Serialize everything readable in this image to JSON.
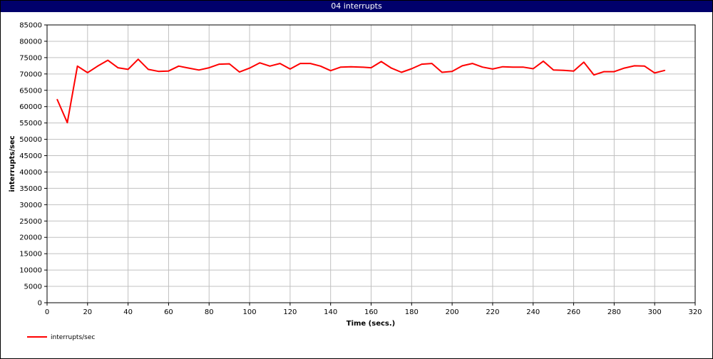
{
  "window": {
    "title": "04 interrupts"
  },
  "chart_data": {
    "type": "line",
    "title": "04 interrupts",
    "xlabel": "Time (secs.)",
    "ylabel": "interrupts/sec",
    "xlim": [
      0,
      320
    ],
    "ylim": [
      0,
      85000
    ],
    "x_ticks": [
      0,
      20,
      40,
      60,
      80,
      100,
      120,
      140,
      160,
      180,
      200,
      220,
      240,
      260,
      280,
      300,
      320
    ],
    "y_ticks": [
      0,
      5000,
      10000,
      15000,
      20000,
      25000,
      30000,
      35000,
      40000,
      45000,
      50000,
      55000,
      60000,
      65000,
      70000,
      75000,
      80000,
      85000
    ],
    "grid": true,
    "legend_position": "bottom-left",
    "colors": {
      "series": "#ff0000",
      "grid": "#c0c0c0",
      "titlebar": "#00006b"
    },
    "series": [
      {
        "name": "interrupts/sec",
        "x": [
          5,
          10,
          15,
          20,
          25,
          30,
          35,
          40,
          45,
          50,
          55,
          60,
          65,
          70,
          75,
          80,
          85,
          90,
          95,
          100,
          105,
          110,
          115,
          120,
          125,
          130,
          135,
          140,
          145,
          150,
          155,
          160,
          165,
          170,
          175,
          180,
          185,
          190,
          195,
          200,
          205,
          210,
          215,
          220,
          225,
          230,
          235,
          240,
          245,
          250,
          255,
          260,
          265,
          270,
          275,
          280,
          285,
          290,
          295,
          300,
          305
        ],
        "values": [
          62200,
          55100,
          72400,
          70400,
          72400,
          74200,
          71900,
          71400,
          74500,
          71400,
          70800,
          70900,
          72400,
          71800,
          71200,
          71900,
          73000,
          73100,
          70600,
          71800,
          73400,
          72400,
          73200,
          71500,
          73200,
          73200,
          72400,
          71000,
          72100,
          72200,
          72100,
          71900,
          73800,
          71800,
          70500,
          71600,
          73000,
          73200,
          70500,
          70800,
          72500,
          73200,
          72100,
          71500,
          72200,
          72100,
          72100,
          71600,
          73900,
          71200,
          71100,
          70900,
          73600,
          69700,
          70700,
          70700,
          71800,
          72500,
          72400,
          70300,
          71100
        ]
      }
    ]
  }
}
